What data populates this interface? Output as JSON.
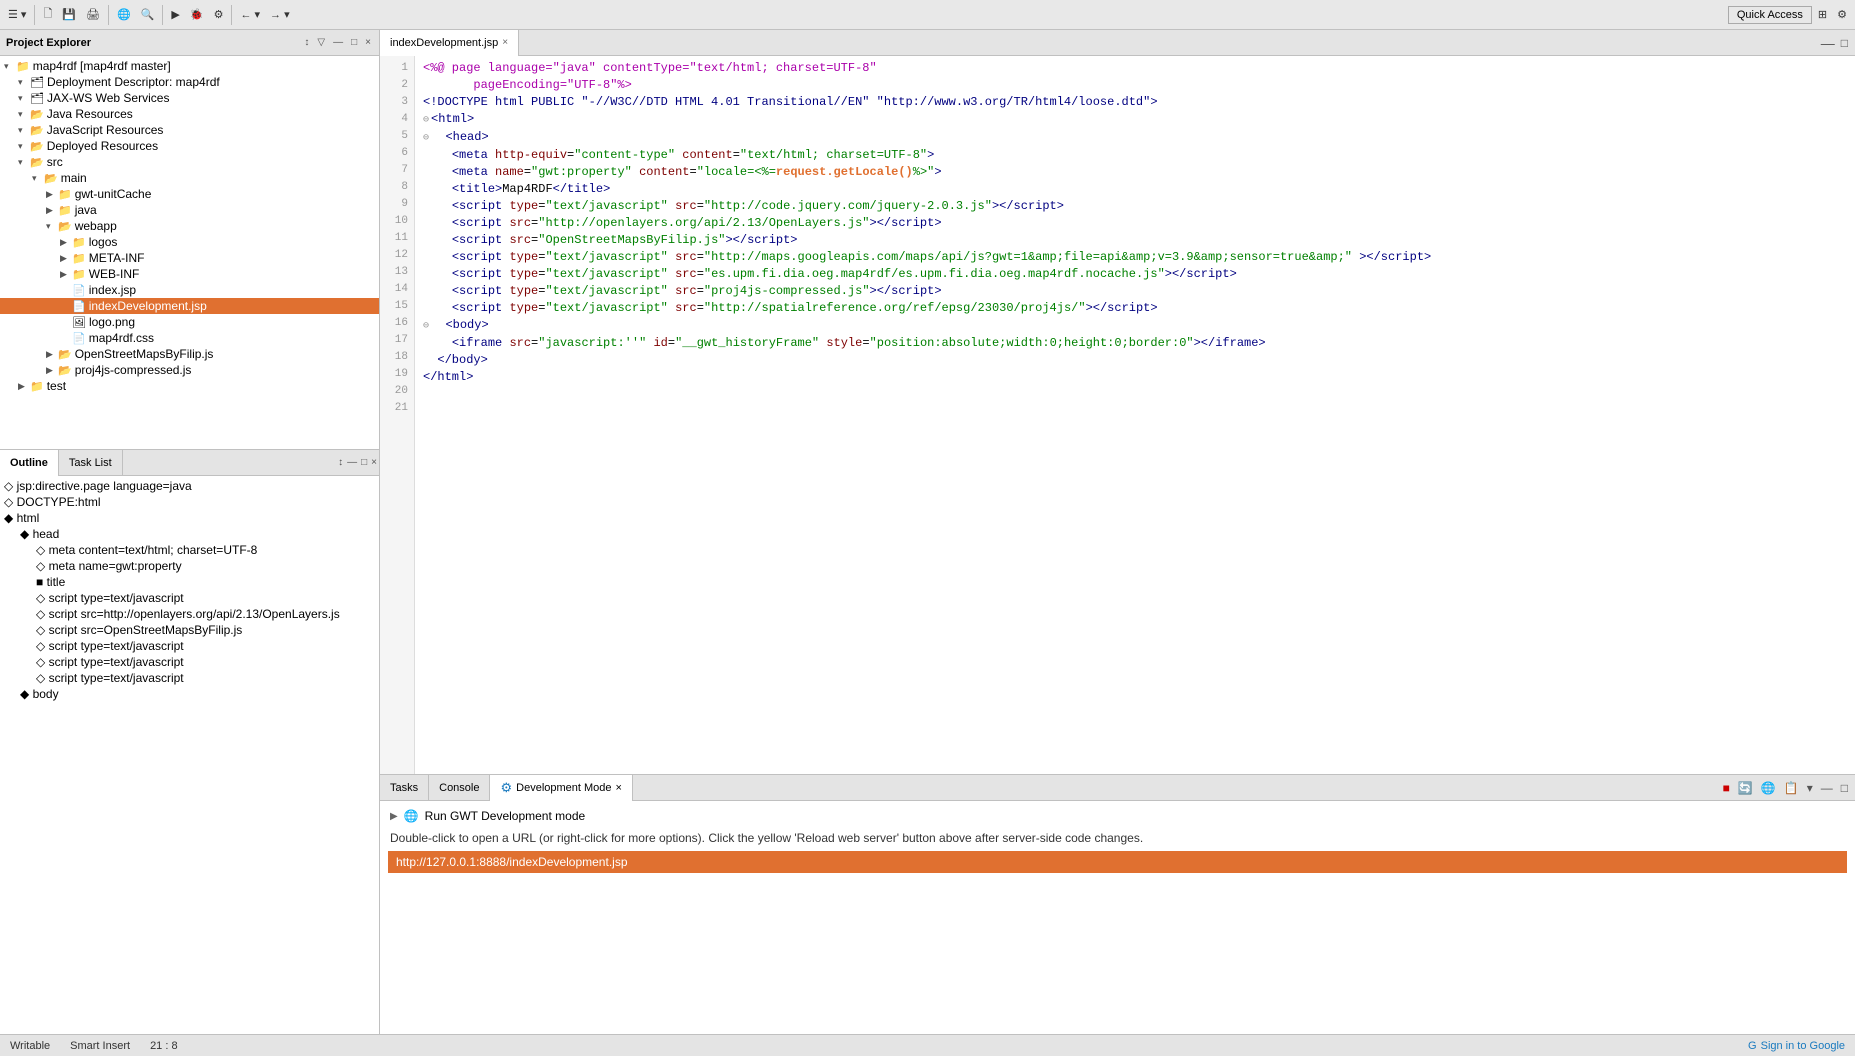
{
  "toolbar": {
    "quick_access_label": "Quick Access"
  },
  "project_explorer": {
    "title": "Project Explorer",
    "close_icon": "×",
    "tree": [
      {
        "id": "map4rdf",
        "indent": 0,
        "arrow": "▾",
        "icon": "📁",
        "label": "map4rdf [map4rdf master]",
        "selected": false
      },
      {
        "id": "deployment",
        "indent": 1,
        "arrow": "▾",
        "icon": "🗂",
        "label": "Deployment Descriptor: map4rdf",
        "selected": false
      },
      {
        "id": "jaxws",
        "indent": 1,
        "arrow": "▾",
        "icon": "🗂",
        "label": "JAX-WS Web Services",
        "selected": false
      },
      {
        "id": "java-res",
        "indent": 1,
        "arrow": "▾",
        "icon": "📂",
        "label": "Java Resources",
        "selected": false
      },
      {
        "id": "js-res",
        "indent": 1,
        "arrow": "▾",
        "icon": "📂",
        "label": "JavaScript Resources",
        "selected": false
      },
      {
        "id": "deployed",
        "indent": 1,
        "arrow": "▾",
        "icon": "📂",
        "label": "Deployed Resources",
        "selected": false
      },
      {
        "id": "src",
        "indent": 1,
        "arrow": "▾",
        "icon": "📂",
        "label": "src",
        "selected": false
      },
      {
        "id": "main",
        "indent": 2,
        "arrow": "▾",
        "icon": "📂",
        "label": "main",
        "selected": false
      },
      {
        "id": "gwt-unitcache",
        "indent": 3,
        "arrow": "▶",
        "icon": "📁",
        "label": "gwt-unitCache",
        "selected": false
      },
      {
        "id": "java",
        "indent": 3,
        "arrow": "▶",
        "icon": "📁",
        "label": "java",
        "selected": false
      },
      {
        "id": "webapp",
        "indent": 3,
        "arrow": "▾",
        "icon": "📂",
        "label": "webapp",
        "selected": false
      },
      {
        "id": "logos",
        "indent": 4,
        "arrow": "▶",
        "icon": "📁",
        "label": "logos",
        "selected": false
      },
      {
        "id": "meta-inf",
        "indent": 4,
        "arrow": "▶",
        "icon": "📁",
        "label": "META-INF",
        "selected": false
      },
      {
        "id": "web-inf",
        "indent": 4,
        "arrow": "▶",
        "icon": "📁",
        "label": "WEB-INF",
        "selected": false
      },
      {
        "id": "indexjsp",
        "indent": 4,
        "arrow": "",
        "icon": "📄",
        "label": "index.jsp",
        "selected": false
      },
      {
        "id": "indexdev",
        "indent": 4,
        "arrow": "",
        "icon": "📄",
        "label": "indexDevelopment.jsp",
        "selected": true
      },
      {
        "id": "logopng",
        "indent": 4,
        "arrow": "",
        "icon": "🖼",
        "label": "logo.png",
        "selected": false
      },
      {
        "id": "map4rdfcss",
        "indent": 4,
        "arrow": "",
        "icon": "📄",
        "label": "map4rdf.css",
        "selected": false
      },
      {
        "id": "openstreetmaps",
        "indent": 3,
        "arrow": "▶",
        "icon": "📂",
        "label": "OpenStreetMapsByFilip.js",
        "selected": false
      },
      {
        "id": "proj4js",
        "indent": 3,
        "arrow": "▶",
        "icon": "📂",
        "label": "proj4js-compressed.js",
        "selected": false
      },
      {
        "id": "test",
        "indent": 1,
        "arrow": "▶",
        "icon": "📁",
        "label": "test",
        "selected": false
      }
    ]
  },
  "editor": {
    "tab_label": "indexDevelopment.jsp",
    "close_icon": "×",
    "lines": [
      {
        "num": 1,
        "fold": false,
        "content_html": "<span class='c-jsp'>&lt;%@ page language=\"java\" contentType=\"text/html; charset=UTF-8\"</span>"
      },
      {
        "num": 2,
        "fold": false,
        "content_html": "<span class='c-jsp'>       pageEncoding=\"UTF-8\"%&gt;</span>"
      },
      {
        "num": 3,
        "fold": false,
        "content_html": "<span class='c-tag'>&lt;!DOCTYPE html PUBLIC \"-//W3C//DTD HTML 4.01 Transitional//EN\" \"http://www.w3.org/TR/html4/loose.dtd\"&gt;</span>"
      },
      {
        "num": 4,
        "fold": true,
        "content_html": "<span class='c-tag'>&lt;html&gt;</span>"
      },
      {
        "num": 5,
        "fold": true,
        "content_html": "  <span class='c-tag'>&lt;head&gt;</span>"
      },
      {
        "num": 6,
        "fold": false,
        "content_html": "    <span class='c-tag'>&lt;meta</span> <span class='c-attr'>http-equiv</span>=<span class='c-val'>\"content-type\"</span> <span class='c-attr'>content</span>=<span class='c-val'>\"text/html; charset=UTF-8\"</span><span class='c-tag'>&gt;</span>"
      },
      {
        "num": 7,
        "fold": false,
        "content_html": "    <span class='c-tag'>&lt;meta</span> <span class='c-attr'>name</span>=<span class='c-val'>\"gwt:property\"</span> <span class='c-attr'>content</span>=<span class='c-val'>\"locale=&lt;%=</span><span class='c-orange'>request.getLocale()</span><span class='c-val'>%&gt;\"</span><span class='c-tag'>&gt;</span>"
      },
      {
        "num": 8,
        "fold": false,
        "content_html": "    <span class='c-tag'>&lt;title&gt;</span><span class='c-text'>Map4RDF</span><span class='c-tag'>&lt;/title&gt;</span>"
      },
      {
        "num": 9,
        "fold": false,
        "content_html": "    <span class='c-tag'>&lt;script</span> <span class='c-attr'>type</span>=<span class='c-val'>\"text/javascript\"</span> <span class='c-attr'>src</span>=<span class='c-val'>\"http://code.jquery.com/jquery-2.0.3.js\"</span><span class='c-tag'>&gt;&lt;/script&gt;</span>"
      },
      {
        "num": 10,
        "fold": false,
        "content_html": "    <span class='c-tag'>&lt;script</span> <span class='c-attr'>src</span>=<span class='c-val'>\"http://openlayers.org/api/2.13/OpenLayers.js\"</span><span class='c-tag'>&gt;&lt;/script&gt;</span>"
      },
      {
        "num": 11,
        "fold": false,
        "content_html": "    <span class='c-tag'>&lt;script</span> <span class='c-attr'>src</span>=<span class='c-val'>\"OpenStreetMapsByFilip.js\"</span><span class='c-tag'>&gt;&lt;/script&gt;</span>"
      },
      {
        "num": 12,
        "fold": false,
        "content_html": "    <span class='c-tag'>&lt;script</span> <span class='c-attr'>type</span>=<span class='c-val'>\"text/javascript\"</span> <span class='c-attr'>src</span>=<span class='c-val'>\"http://maps.googleapis.com/maps/api/js?gwt=1&amp;amp;file=api&amp;amp;v=3.9&amp;amp;sensor=true&amp;amp;\"</span> <span class='c-tag'>&gt;&lt;/script&gt;</span>"
      },
      {
        "num": 13,
        "fold": false,
        "content_html": "    <span class='c-tag'>&lt;script</span> <span class='c-attr'>type</span>=<span class='c-val'>\"text/javascript\"</span> <span class='c-attr'>src</span>=<span class='c-val'>\"es.upm.fi.dia.oeg.map4rdf/es.upm.fi.dia.oeg.map4rdf.nocache.js\"</span><span class='c-tag'>&gt;&lt;/script&gt;</span>"
      },
      {
        "num": 14,
        "fold": false,
        "content_html": "    <span class='c-tag'>&lt;script</span> <span class='c-attr'>type</span>=<span class='c-val'>\"text/javascript\"</span> <span class='c-attr'>src</span>=<span class='c-val'>\"proj4js-compressed.js\"</span><span class='c-tag'>&gt;&lt;/script&gt;</span>"
      },
      {
        "num": 15,
        "fold": false,
        "content_html": "    <span class='c-tag'>&lt;script</span> <span class='c-attr'>type</span>=<span class='c-val'>\"text/javascript\"</span> <span class='c-attr'>src</span>=<span class='c-val'>\"http://spatialreference.org/ref/epsg/23030/proj4js/\"</span><span class='c-tag'>&gt;&lt;/script&gt;</span>"
      },
      {
        "num": 16,
        "fold": false,
        "content_html": ""
      },
      {
        "num": 17,
        "fold": false,
        "content_html": ""
      },
      {
        "num": 18,
        "fold": true,
        "content_html": "  <span class='c-tag'>&lt;body&gt;</span>"
      },
      {
        "num": 19,
        "fold": false,
        "content_html": "    <span class='c-tag'>&lt;iframe</span> <span class='c-attr'>src</span>=<span class='c-val'>\"javascript:''\"</span> <span class='c-attr'>id</span>=<span class='c-val'>\"__gwt_historyFrame\"</span> <span class='c-attr'>style</span>=<span class='c-val'>\"position:absolute;width:0;height:0;border:0\"</span><span class='c-tag'>&gt;&lt;/iframe&gt;</span>"
      },
      {
        "num": 20,
        "fold": false,
        "content_html": "  <span class='c-tag'>&lt;/body&gt;</span>"
      },
      {
        "num": 21,
        "fold": false,
        "content_html": "<span class='c-tag'>&lt;/html&gt;</span>"
      }
    ]
  },
  "outline": {
    "tabs": [
      {
        "id": "outline",
        "label": "Outline",
        "active": true
      },
      {
        "id": "tasklist",
        "label": "Task List",
        "active": false
      }
    ],
    "items": [
      {
        "indent": 0,
        "arrow": "",
        "icon": "",
        "label": "◇ jsp:directive.page language=java"
      },
      {
        "indent": 0,
        "arrow": "",
        "icon": "",
        "label": "◇ DOCTYPE:html"
      },
      {
        "indent": 0,
        "arrow": "▾",
        "icon": "",
        "label": "◆ html"
      },
      {
        "indent": 1,
        "arrow": "▾",
        "icon": "",
        "label": "◆ head"
      },
      {
        "indent": 2,
        "arrow": "",
        "icon": "",
        "label": "◇ meta content=text/html; charset=UTF-8"
      },
      {
        "indent": 2,
        "arrow": "",
        "icon": "",
        "label": "◇ meta name=gwt:property"
      },
      {
        "indent": 2,
        "arrow": "",
        "icon": "",
        "label": "■ title"
      },
      {
        "indent": 2,
        "arrow": "",
        "icon": "",
        "label": "◇ script type=text/javascript"
      },
      {
        "indent": 2,
        "arrow": "",
        "icon": "",
        "label": "◇ script src=http://openlayers.org/api/2.13/OpenLayers.js"
      },
      {
        "indent": 2,
        "arrow": "",
        "icon": "",
        "label": "◇ script src=OpenStreetMapsByFilip.js"
      },
      {
        "indent": 2,
        "arrow": "",
        "icon": "",
        "label": "◇ script type=text/javascript"
      },
      {
        "indent": 2,
        "arrow": "",
        "icon": "",
        "label": "◇ script type=text/javascript"
      },
      {
        "indent": 2,
        "arrow": "",
        "icon": "",
        "label": "◇ script type=text/javascript"
      },
      {
        "indent": 1,
        "arrow": "▾",
        "icon": "",
        "label": "◆ body"
      }
    ]
  },
  "bottom_panel": {
    "tabs": [
      {
        "id": "tasks",
        "label": "Tasks",
        "active": false
      },
      {
        "id": "console",
        "label": "Console",
        "active": false
      },
      {
        "id": "devmode",
        "label": "Development Mode",
        "active": true,
        "close_icon": "×"
      }
    ],
    "dev_mode": {
      "run_label": "Run GWT Development mode",
      "hint": "Double-click to open a URL (or right-click for more options). Click the yellow 'Reload web server' button above after server-side code changes.",
      "url": "http://127.0.0.1:8888/indexDevelopment.jsp"
    }
  },
  "status_bar": {
    "writable": "Writable",
    "smart_insert": "Smart Insert",
    "position": "21 : 8",
    "sign_in": "Sign in to Google"
  }
}
